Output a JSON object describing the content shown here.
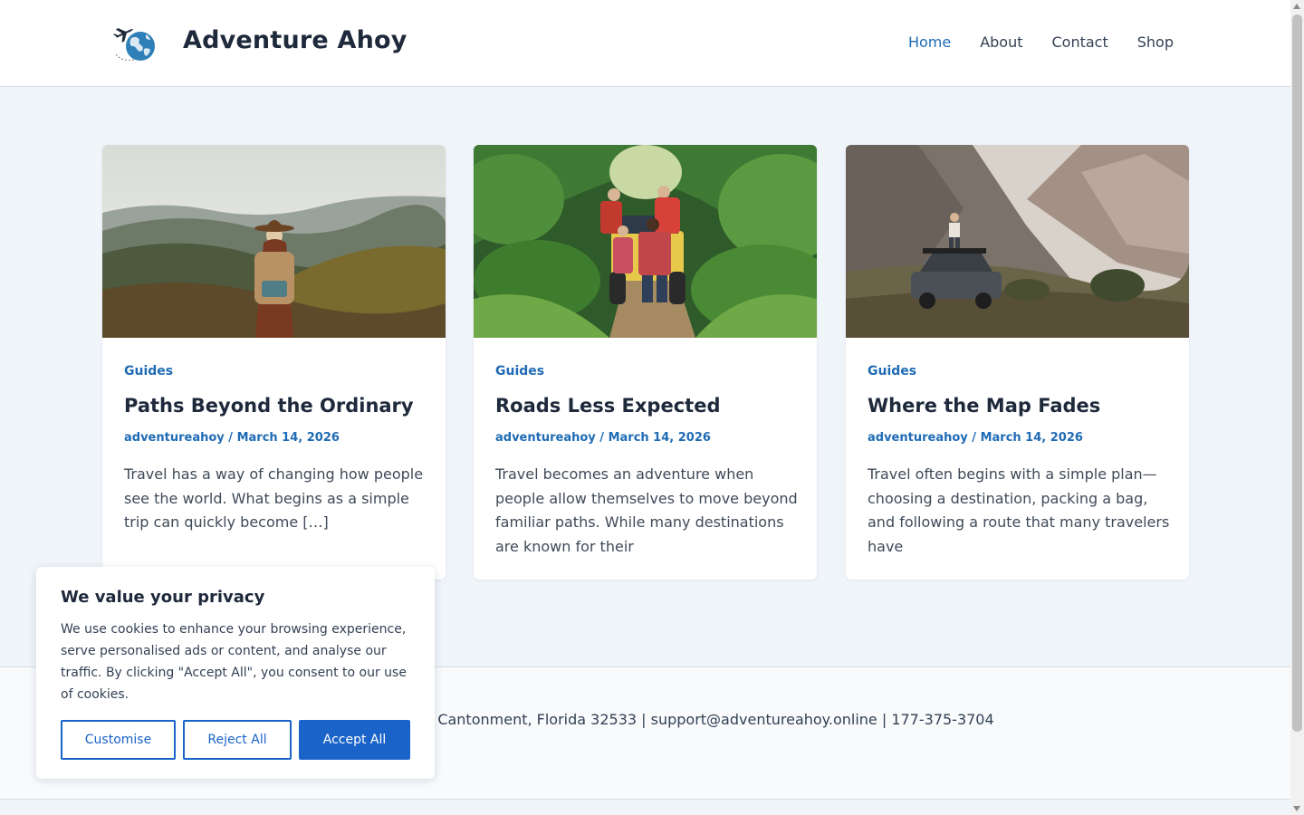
{
  "header": {
    "site_title": "Adventure Ahoy",
    "logo_icon": "globe-airplane-icon",
    "nav": [
      {
        "label": "Home",
        "active": true
      },
      {
        "label": "About",
        "active": false
      },
      {
        "label": "Contact",
        "active": false
      },
      {
        "label": "Shop",
        "active": false
      }
    ]
  },
  "posts": [
    {
      "category": "Guides",
      "title": "Paths Beyond the Ordinary",
      "author": "adventureahoy",
      "separator": "/",
      "date": "March 14, 2026",
      "excerpt": "Travel has a way of changing how people see the world. What begins as a simple trip can quickly become […]"
    },
    {
      "category": "Guides",
      "title": "Roads Less Expected",
      "author": "adventureahoy",
      "separator": "/",
      "date": "March 14, 2026",
      "excerpt": "Travel becomes an adventure when people allow themselves to move beyond familiar paths. While many destinations are known for their"
    },
    {
      "category": "Guides",
      "title": "Where the Map Fades",
      "author": "adventureahoy",
      "separator": "/",
      "date": "March 14, 2026",
      "excerpt": "Travel often begins with a simple plan—choosing a destination, packing a bag, and following a route that many travelers have"
    }
  ],
  "footer": {
    "contact_line": "Cantonment, Florida 32533 | support@adventureahoy.online | 177-375-3704"
  },
  "cookie_banner": {
    "title": "We value your privacy",
    "body": "We use cookies to enhance your browsing experience, serve personalised ads or content, and analyse our traffic. By clicking \"Accept All\", you consent to our use of cookies.",
    "customise_label": "Customise",
    "reject_label": "Reject All",
    "accept_label": "Accept All"
  },
  "colors": {
    "accent": "#1f6bb5",
    "button_blue": "#1a63c9",
    "page_bg": "#f0f5fa"
  }
}
